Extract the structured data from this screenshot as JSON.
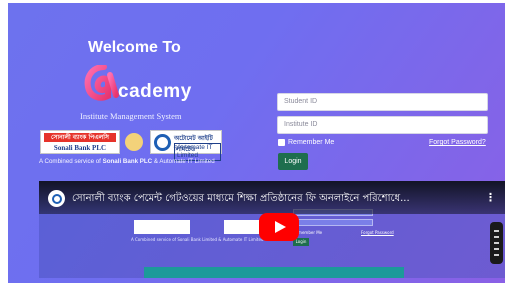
{
  "welcome": "Welcome To",
  "logo_word": "cademy",
  "tagline": "Institute Management System",
  "partners": {
    "bank_top": "সোনালী ব্যাংক পিএলসি",
    "bank_name": "Sonali Bank PLC",
    "automate_top": "অটোমেট আইটি লিমিটেড",
    "automate_name": "Automate IT Limited"
  },
  "combined_prefix": "A Combined service of ",
  "combined_bank": "Sonali Bank PLC",
  "combined_mid": " & ",
  "combined_it": "Automate IT Limited",
  "form": {
    "student_id_placeholder": "Student ID",
    "institute_id_placeholder": "Institute ID",
    "remember_label": "Remember Me",
    "forgot_label": "Forgot Password?",
    "login_label": "Login"
  },
  "video": {
    "title": "সোনালী ব্যাংক পেমেন্ট গেটওয়ের মাধ্যমে শিক্ষা প্রতিষ্ঠানের ফি অনলাইনে পরিশোধে...",
    "menu": "⋮",
    "mini": {
      "combined": "A Combined service of Sonali Bank Limited & Automate IT Limited",
      "student_placeholder": "Student ID",
      "institute_placeholder": "Institute ID",
      "remember": "Remember Me",
      "forgot": "Forgot Password",
      "login": "Login"
    }
  },
  "colors": {
    "brand_green": "#1e6e4e",
    "youtube_red": "#ff0000"
  }
}
